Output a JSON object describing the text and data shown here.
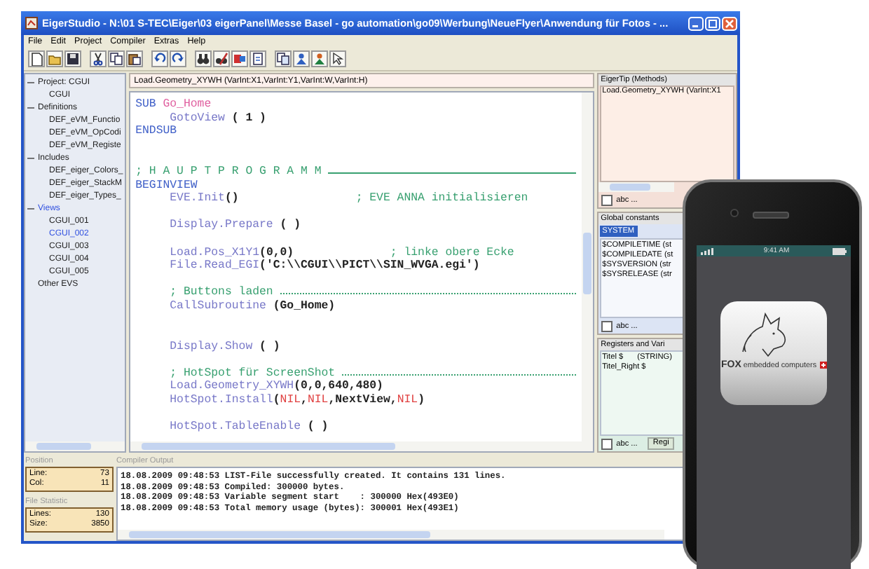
{
  "window": {
    "title": "EigerStudio - N:\\01  S-TEC\\Eiger\\03 eigerPanel\\Messe Basel - go automation\\go09\\Werbung\\NeueFlyer\\Anwendung für Fotos - ..."
  },
  "menu": [
    "File",
    "Edit",
    "Project",
    "Compiler",
    "Extras",
    "Help"
  ],
  "tree": [
    {
      "label": "Project: CGUI",
      "expanded": true,
      "selected": false,
      "children": [
        {
          "label": "CGUI",
          "selected": false
        }
      ]
    },
    {
      "label": "Definitions",
      "expanded": true,
      "selected": false,
      "children": [
        {
          "label": "DEF_eVM_Functio",
          "selected": false
        },
        {
          "label": "DEF_eVM_OpCodi",
          "selected": false
        },
        {
          "label": "DEF_eVM_Registe",
          "selected": false
        }
      ]
    },
    {
      "label": "Includes",
      "expanded": true,
      "selected": false,
      "children": [
        {
          "label": "DEF_eiger_Colors_",
          "selected": false
        },
        {
          "label": "DEF_eiger_StackM",
          "selected": false
        },
        {
          "label": "DEF_eiger_Types_",
          "selected": false
        }
      ]
    },
    {
      "label": "Views",
      "expanded": true,
      "selected": true,
      "children": [
        {
          "label": "CGUI_001",
          "selected": false
        },
        {
          "label": "CGUI_002",
          "selected": true
        },
        {
          "label": "CGUI_003",
          "selected": false
        },
        {
          "label": "CGUI_004",
          "selected": false
        },
        {
          "label": "CGUI_005",
          "selected": false
        }
      ]
    },
    {
      "label": "Other EVS",
      "selected": false
    }
  ],
  "editor": {
    "signature": "Load.Geometry_XYWH (VarInt:X1,VarInt:Y1,VarInt:W,VarInt:H)",
    "lines": [
      {
        "kind": "code",
        "segments": [
          {
            "kind": "keyword",
            "text": "SUB "
          },
          {
            "kind": "name",
            "text": "Go_Home"
          }
        ]
      },
      {
        "kind": "code",
        "segments": [
          {
            "kind": "func",
            "text": "     GotoView "
          },
          {
            "kind": "plain",
            "text": "( 1 )"
          }
        ]
      },
      {
        "kind": "code",
        "segments": [
          {
            "kind": "keyword",
            "text": "ENDSUB"
          }
        ]
      },
      {
        "kind": "blank"
      },
      {
        "kind": "blank"
      },
      {
        "kind": "rule",
        "segments": [
          {
            "kind": "comment",
            "text": "; H A U P T P R O G R A M M "
          }
        ]
      },
      {
        "kind": "code",
        "segments": [
          {
            "kind": "keyword",
            "text": "BEGINVIEW"
          }
        ]
      },
      {
        "kind": "code",
        "segments": [
          {
            "kind": "func",
            "text": "     EVE.Init"
          },
          {
            "kind": "plain",
            "text": "()                 "
          },
          {
            "kind": "comment",
            "text": "; EVE ANNA initialisieren"
          }
        ]
      },
      {
        "kind": "blank"
      },
      {
        "kind": "code",
        "segments": [
          {
            "kind": "func",
            "text": "     Display.Prepare "
          },
          {
            "kind": "plain",
            "text": "( )"
          }
        ]
      },
      {
        "kind": "blank"
      },
      {
        "kind": "code",
        "segments": [
          {
            "kind": "func",
            "text": "     Load.Pos_X1Y1"
          },
          {
            "kind": "plain",
            "text": "(0,0)              "
          },
          {
            "kind": "comment",
            "text": "; linke obere Ecke"
          }
        ]
      },
      {
        "kind": "code",
        "segments": [
          {
            "kind": "func",
            "text": "     File.Read_EGI"
          },
          {
            "kind": "plain",
            "text": "('C:\\\\CGUI\\\\PICT\\\\SIN_WVGA.egi')"
          }
        ]
      },
      {
        "kind": "blank"
      },
      {
        "kind": "dotted",
        "segments": [
          {
            "kind": "comment",
            "text": "     ; Buttons laden "
          }
        ]
      },
      {
        "kind": "code",
        "segments": [
          {
            "kind": "func",
            "text": "     CallSubroutine "
          },
          {
            "kind": "plain",
            "text": "(Go_Home)"
          }
        ]
      },
      {
        "kind": "blank"
      },
      {
        "kind": "blank"
      },
      {
        "kind": "code",
        "segments": [
          {
            "kind": "func",
            "text": "     Display.Show "
          },
          {
            "kind": "plain",
            "text": "( )"
          }
        ]
      },
      {
        "kind": "blank"
      },
      {
        "kind": "dotted",
        "segments": [
          {
            "kind": "comment",
            "text": "     ; HotSpot für ScreenShot "
          }
        ]
      },
      {
        "kind": "code",
        "segments": [
          {
            "kind": "func",
            "text": "     Load.Geometry_XYWH"
          },
          {
            "kind": "plain",
            "text": "(0,0,640,480)"
          }
        ]
      },
      {
        "kind": "code",
        "segments": [
          {
            "kind": "func",
            "text": "     HotSpot.Install"
          },
          {
            "kind": "plain",
            "text": "("
          },
          {
            "kind": "nil",
            "text": "NIL"
          },
          {
            "kind": "plain",
            "text": ","
          },
          {
            "kind": "nil",
            "text": "NIL"
          },
          {
            "kind": "plain",
            "text": ",NextView,"
          },
          {
            "kind": "nil",
            "text": "NIL"
          },
          {
            "kind": "plain",
            "text": ")"
          }
        ]
      },
      {
        "kind": "blank"
      },
      {
        "kind": "code",
        "segments": [
          {
            "kind": "func",
            "text": "     HotSpot.TableEnable "
          },
          {
            "kind": "plain",
            "text": "( )"
          }
        ]
      }
    ]
  },
  "eigertip": {
    "title": "EigerTip (Methods)",
    "text": "Load.Geometry_XYWH (VarInt:X1",
    "filter": {
      "label": "abc ...",
      "checked": false
    }
  },
  "global_constants": {
    "title": "Global constants",
    "search": "SYSTEM",
    "items": [
      "$COMPILETIME (st",
      "$COMPILEDATE (st",
      "$SYSVERSION (str",
      "$SYSRELEASE (str"
    ],
    "filter": {
      "label": "abc ...",
      "checked": false
    }
  },
  "registers": {
    "title": "Registers and Vari",
    "items": [
      {
        "name": "Titel $",
        "type": "(STRING)"
      },
      {
        "name": "Titel_Right $"
      }
    ],
    "filter": {
      "label": "abc ...",
      "checked": false
    },
    "tab": "Regi"
  },
  "position": {
    "title": "Position",
    "fields": [
      {
        "label": "Line:",
        "value": "73"
      },
      {
        "label": "Col:",
        "value": "11"
      }
    ]
  },
  "file_statistic": {
    "title": "File Statistic",
    "fields": [
      {
        "label": "Lines:",
        "value": "130"
      },
      {
        "label": "Size:",
        "value": "3850"
      }
    ]
  },
  "compiler_output": {
    "title": "Compiler Output",
    "lines": [
      "18.08.2009 09:48:53 LIST-File successfully created. It contains 131 lines.",
      "18.08.2009 09:48:53 Compiled: 300000 bytes.",
      "18.08.2009 09:48:53 Variable segment start    : 300000 Hex(493E0)",
      "18.08.2009 09:48:53 Total memory usage (bytes): 300001 Hex(493E1)"
    ]
  },
  "phone": {
    "time": "9:41 AM",
    "logo": "**FOX** embedded computers"
  }
}
